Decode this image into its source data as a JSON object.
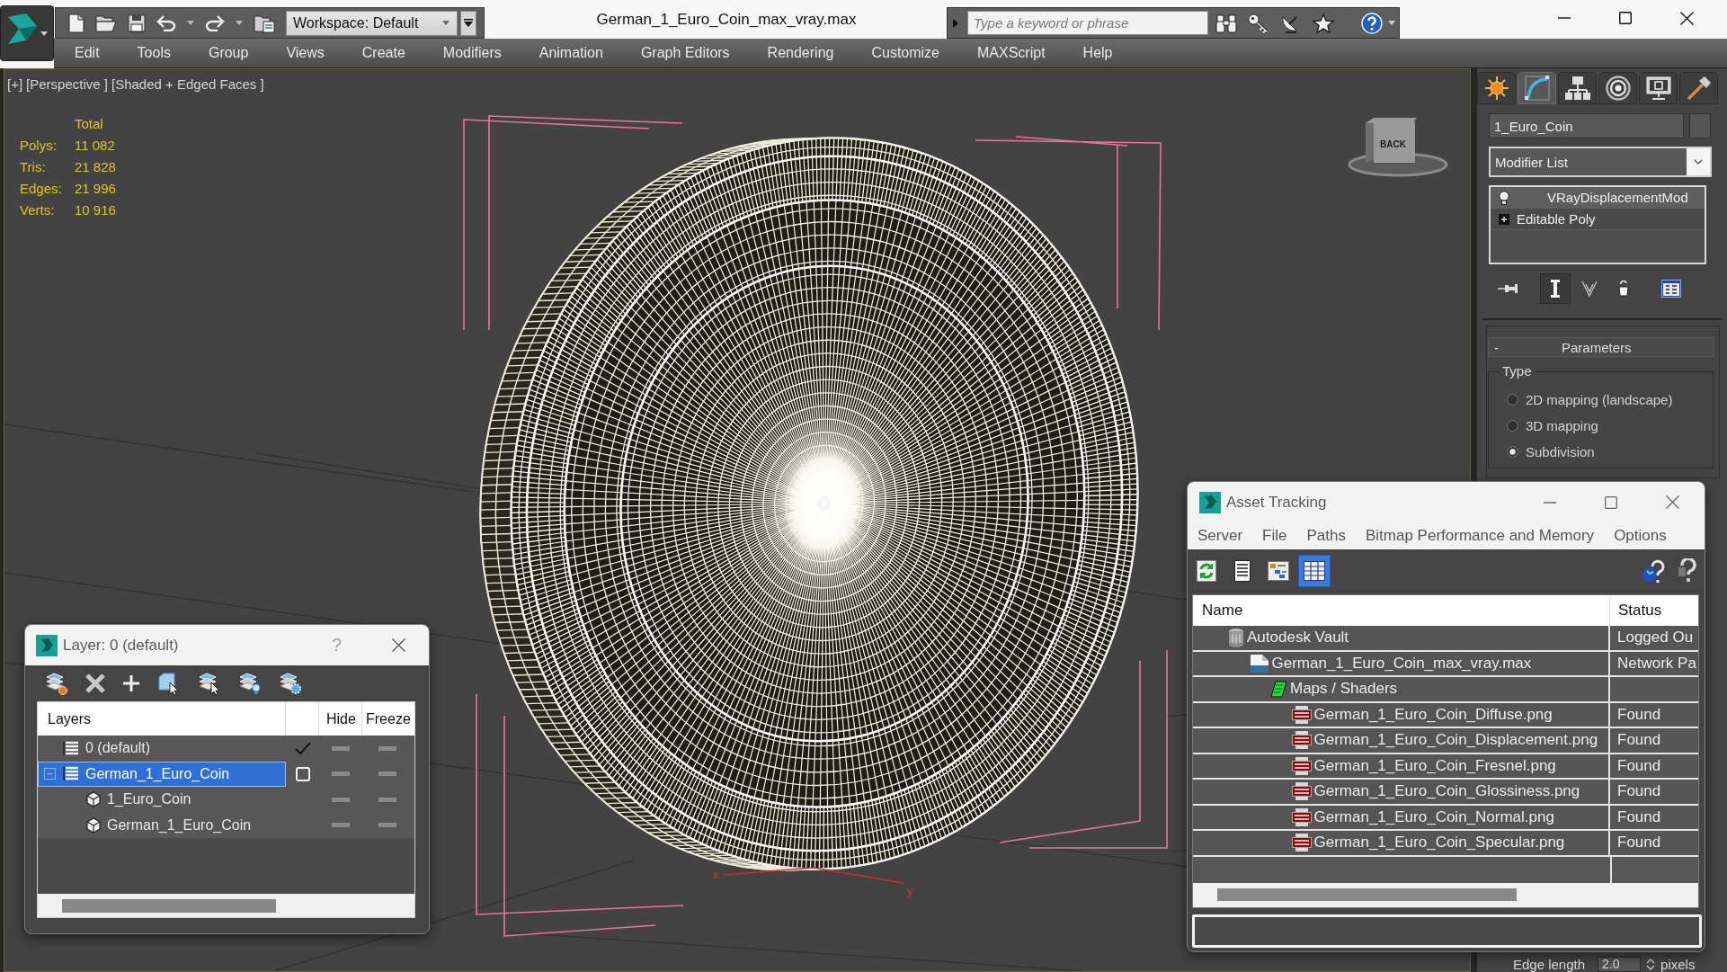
{
  "title_bar": {
    "workspace": "Workspace: Default",
    "title": "German_1_Euro_Coin_max_vray.max",
    "search": {
      "placeholder": "Type a keyword or phrase"
    }
  },
  "menu_bar": [
    "Edit",
    "Tools",
    "Group",
    "Views",
    "Create",
    "Modifiers",
    "Animation",
    "Graph Editors",
    "Rendering",
    "Customize",
    "MAXScript",
    "Help"
  ],
  "viewport": {
    "labels": [
      "[+]",
      "[Perspective ]",
      "[Shaded + Edged Faces ]"
    ],
    "stats": {
      "heading": "Total",
      "rows": [
        {
          "label": "Polys:",
          "value": "11 082"
        },
        {
          "label": "Tris:",
          "value": "21 828"
        },
        {
          "label": "Edges:",
          "value": "21 996"
        },
        {
          "label": "Verts:",
          "value": "10 916"
        }
      ]
    },
    "viewcube_label": "BACK",
    "axis_labels": [
      "x",
      "y"
    ]
  },
  "command_panel": {
    "tabs": [
      {
        "kind": "create",
        "selected": false
      },
      {
        "kind": "modify",
        "selected": true
      },
      {
        "kind": "hierarchy",
        "selected": false
      },
      {
        "kind": "motion",
        "selected": false
      },
      {
        "kind": "display",
        "selected": false
      },
      {
        "kind": "utilities",
        "selected": false
      }
    ],
    "object_name": "1_Euro_Coin",
    "modifier_list": "Modifier List",
    "modifier_stack": [
      {
        "label": "VRayDisplacementMod",
        "kind": "modifier",
        "enabled": true,
        "selected": true
      },
      {
        "label": "Editable Poly",
        "kind": "base",
        "expanded": false,
        "selected": false
      }
    ],
    "stack_tools": [
      {
        "kind": "pin",
        "on": false
      },
      {
        "kind": "end-result",
        "on": true
      },
      {
        "kind": "unique",
        "on": false
      },
      {
        "kind": "remove",
        "on": false
      },
      {
        "kind": "configure",
        "on": false
      }
    ],
    "rollout": {
      "collapse_label": "-",
      "title": "Parameters",
      "group": "Type",
      "options": [
        {
          "label": "2D mapping (landscape)",
          "selected": false
        },
        {
          "label": "3D mapping",
          "selected": false
        },
        {
          "label": "Subdivision",
          "selected": true
        }
      ]
    },
    "edge_length": {
      "label": "Edge length",
      "value": "2.0",
      "unit": "pixels"
    }
  },
  "layer_window": {
    "title": "Layer: 0 (default)",
    "help": "?",
    "columns": {
      "name": "Layers",
      "hide": "Hide",
      "freeze": "Freeze"
    },
    "rows": [
      {
        "name": "0 (default)",
        "kind": "layer",
        "selected": false,
        "current": true,
        "hidden": false,
        "frozen": false
      },
      {
        "name": "German_1_Euro_Coin",
        "kind": "layer",
        "selected": true,
        "current": false,
        "expanded": true,
        "hidden": false,
        "frozen": false,
        "children": [
          {
            "name": "1_Euro_Coin",
            "kind": "object",
            "selected": false,
            "hidden": false,
            "frozen": false
          },
          {
            "name": "German_1_Euro_Coin",
            "kind": "object",
            "selected": false,
            "hidden": false,
            "frozen": false
          }
        ]
      }
    ]
  },
  "asset_tracking": {
    "title": "Asset Tracking",
    "menu": [
      "Server",
      "File",
      "Paths",
      "Bitmap Performance and Memory",
      "Options"
    ],
    "toolbar": [
      {
        "kind": "refresh",
        "selected": false
      },
      {
        "kind": "list",
        "selected": false
      },
      {
        "kind": "tree",
        "selected": false
      },
      {
        "kind": "table",
        "selected": true
      }
    ],
    "columns": {
      "name": "Name",
      "status": "Status"
    },
    "rows": [
      {
        "name": "Autodesk Vault",
        "kind": "vault",
        "status": "Logged Ou",
        "selected": false,
        "children": [
          {
            "name": "German_1_Euro_Coin_max_vray.max",
            "kind": "max",
            "status": "Network Pa",
            "selected": false,
            "children": [
              {
                "name": "Maps / Shaders",
                "kind": "folder",
                "selected": false,
                "children": [
                  {
                    "name": "German_1_Euro_Coin_Diffuse.png",
                    "kind": "png",
                    "status": "Found",
                    "selected": false
                  },
                  {
                    "name": "German_1_Euro_Coin_Displacement.png",
                    "kind": "png",
                    "status": "Found",
                    "selected": false
                  },
                  {
                    "name": "German_1_Euro_Coin_Fresnel.png",
                    "kind": "png",
                    "status": "Found",
                    "selected": false
                  },
                  {
                    "name": "German_1_Euro_Coin_Glossiness.png",
                    "kind": "png",
                    "status": "Found",
                    "selected": false
                  },
                  {
                    "name": "German_1_Euro_Coin_Normal.png",
                    "kind": "png",
                    "status": "Found",
                    "selected": false
                  },
                  {
                    "name": "German_1_Euro_Coin_Specular.png",
                    "kind": "png",
                    "status": "Found",
                    "selected": false
                  }
                ]
              }
            ]
          }
        ]
      }
    ]
  }
}
